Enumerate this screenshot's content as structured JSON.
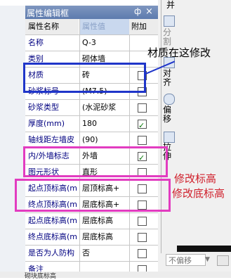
{
  "panel": {
    "title": "属性编辑框",
    "pin_glyph": "ф",
    "close_glyph": "×",
    "headers": {
      "name": "属性名称",
      "value": "属性值",
      "extra": "附加"
    },
    "rows": [
      {
        "name": "名称",
        "value": "Q-3",
        "checkbox": false,
        "checked": false
      },
      {
        "name": "类别",
        "value": "砌体墙",
        "checkbox": false,
        "checked": false
      },
      {
        "name": "材质",
        "value": "砖",
        "checkbox": true,
        "checked": false
      },
      {
        "name": "砂浆标号",
        "value": "(M7.5)",
        "checkbox": true,
        "checked": false
      },
      {
        "name": "砂浆类型",
        "value": "(水泥砂浆",
        "checkbox": true,
        "checked": false
      },
      {
        "name": "厚度(mm)",
        "value": "180",
        "checkbox": true,
        "checked": true
      },
      {
        "name": "轴线距左墙皮",
        "value": "(90)",
        "checkbox": true,
        "checked": false
      },
      {
        "name": "内/外墙标志",
        "value": "外墙",
        "checkbox": true,
        "checked": true
      },
      {
        "name": "图元形状",
        "value": "直形",
        "checkbox": true,
        "checked": false
      },
      {
        "name": "起点顶标高(m",
        "value": "层顶标高+",
        "checkbox": true,
        "checked": false
      },
      {
        "name": "终点顶标高(m",
        "value": "层底标高+",
        "checkbox": true,
        "checked": false
      },
      {
        "name": "起点底标高(m",
        "value": "层底标高",
        "checkbox": true,
        "checked": false
      },
      {
        "name": "终点底标高(m",
        "value": "层底标高",
        "checkbox": true,
        "checked": false
      },
      {
        "name": "是否为人防构",
        "value": "否",
        "checkbox": true,
        "checked": false
      },
      {
        "name": "备注",
        "value": "",
        "checkbox": true,
        "checked": false
      }
    ]
  },
  "toolbar": {
    "top_fragment": "并",
    "split": "分割",
    "align": "对齐",
    "offset": "偏移",
    "stretch": "拉伸",
    "offset_combo": "不偏移",
    "combo_arrow": "▼"
  },
  "annotations": {
    "material_note": "材质在这修改",
    "top_elev_note": "修改标高",
    "bottom_elev_note": "修改底标高"
  },
  "status": {
    "text": "砌块底标高"
  }
}
